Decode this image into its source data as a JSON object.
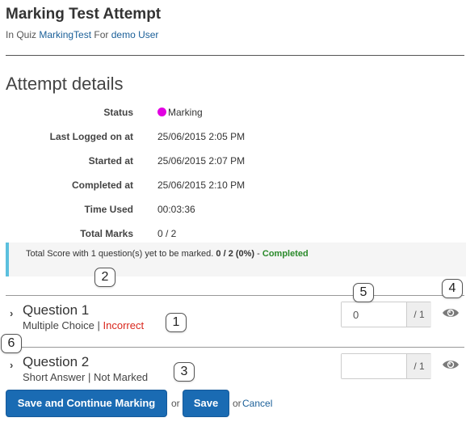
{
  "header": {
    "title": "Marking Test Attempt",
    "in_quiz_prefix": "In Quiz",
    "quiz_link": "MarkingTest",
    "for_word": "For",
    "user_link": "demo User"
  },
  "details": {
    "section_title": "Attempt details",
    "rows": [
      {
        "label": "Status",
        "value": "Marking"
      },
      {
        "label": "Last Logged on at",
        "value": "25/06/2015 2:05 PM"
      },
      {
        "label": "Started at",
        "value": "25/06/2015 2:07 PM"
      },
      {
        "label": "Completed at",
        "value": "25/06/2015 2:10 PM"
      },
      {
        "label": "Time Used",
        "value": "00:03:36"
      },
      {
        "label": "Total Marks",
        "value": "0 / 2"
      }
    ],
    "status_color": "#e100e1"
  },
  "score": {
    "prefix": "Total Score with 1 question(s) yet to be marked.",
    "score": "0 / 2 (0%)",
    "separator": "-",
    "state": "Completed",
    "accent_color": "#5bc0de",
    "state_color": "#2a8a2a"
  },
  "questions": [
    {
      "title": "Question 1",
      "type": "Multiple Choice",
      "separator": "|",
      "result": "Incorrect",
      "mark_value": "0",
      "mark_max": "/ 1",
      "result_color": "#d9261c"
    },
    {
      "title": "Question 2",
      "type": "Short Answer",
      "separator": "|",
      "result": "Not Marked",
      "mark_value": "",
      "mark_max": "/ 1"
    }
  ],
  "callouts": [
    "1",
    "2",
    "3",
    "4",
    "5",
    "6"
  ],
  "actions": {
    "save_continue": "Save and Continue Marking",
    "or1": "or",
    "save": "Save",
    "or2": "or",
    "cancel": "Cancel",
    "button_color": "#1a6bb3"
  },
  "icons": {
    "chevron": "chevron-right-icon",
    "eye": "eye-icon"
  }
}
